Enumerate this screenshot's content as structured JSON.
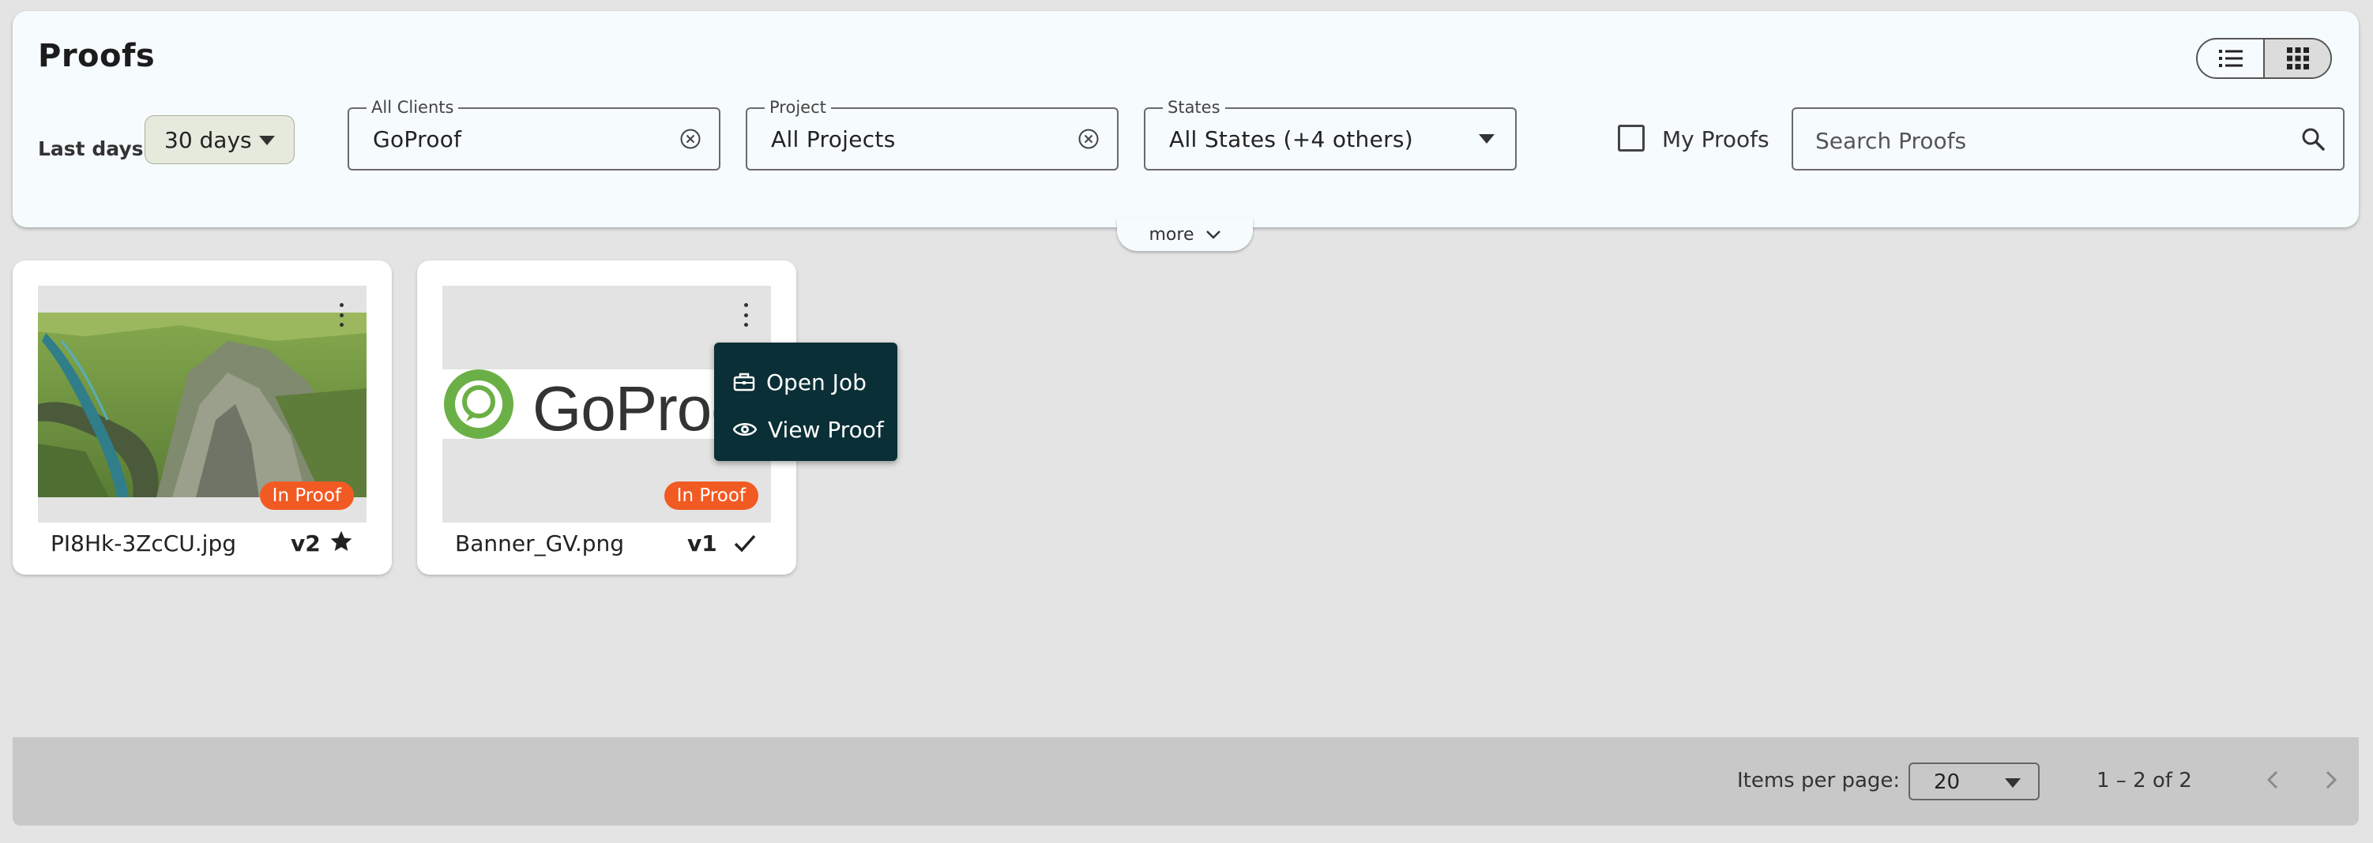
{
  "header": {
    "title": "Proofs",
    "view_toggle": {
      "list_icon": "list-icon",
      "grid_icon": "grid-icon",
      "active": "grid"
    }
  },
  "filters": {
    "last_days_label": "Last days",
    "last_days_value": "30 days",
    "clients": {
      "legend": "All Clients",
      "value": "GoProof"
    },
    "project": {
      "legend": "Project",
      "value": "All Projects"
    },
    "states": {
      "legend": "States",
      "value": "All States (+4 others)"
    },
    "my_proofs_label": "My Proofs",
    "my_proofs_checked": false,
    "search_placeholder": "Search Proofs",
    "more_label": "more"
  },
  "cards": [
    {
      "file_name": "PI8Hk-3ZcCU.jpg",
      "version": "v2",
      "state": "In Proof",
      "status_icon": "star-icon",
      "thumbnail": "canyon-landscape-photo"
    },
    {
      "file_name": "Banner_GV.png",
      "version": "v1",
      "state": "In Proof",
      "status_icon": "check-icon",
      "thumbnail": "goproof-logo-banner",
      "thumbnail_text": "GoProof"
    }
  ],
  "context_menu": {
    "items": [
      {
        "label": "Open Job",
        "icon": "briefcase-icon"
      },
      {
        "label": "View Proof",
        "icon": "eye-icon"
      }
    ]
  },
  "paginator": {
    "items_per_page_label": "Items per page:",
    "items_per_page_value": "20",
    "range_label": "1 – 2 of 2"
  },
  "colors": {
    "badge": "#f25a23",
    "menu_bg": "#0a2f36",
    "logo_green": "#6bb046",
    "panel_bg": "#f6fbfd"
  }
}
